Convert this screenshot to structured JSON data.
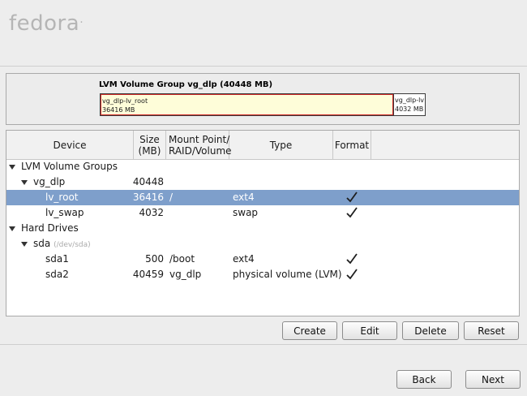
{
  "header": {
    "logo_text": "fedora",
    "logo_mark": "."
  },
  "vg_graphic": {
    "title": "LVM Volume Group vg_dlp (40448 MB)",
    "segments": [
      {
        "name": "vg_dlp-lv_root",
        "size": "36416 MB"
      },
      {
        "name": "vg_dlp-lv",
        "size": "4032 MB"
      }
    ]
  },
  "table": {
    "columns": {
      "device": "Device",
      "size_1": "Size",
      "size_2": "(MB)",
      "mount_1": "Mount Point/",
      "mount_2": "RAID/Volume",
      "type": "Type",
      "format": "Format"
    },
    "rows": [
      {
        "device": "LVM Volume Groups"
      },
      {
        "device": "vg_dlp",
        "size": "40448"
      },
      {
        "device": "lv_root",
        "size": "36416",
        "mount": "/",
        "type": "ext4",
        "format": true,
        "selected": true
      },
      {
        "device": "lv_swap",
        "size": "4032",
        "mount": "",
        "type": "swap",
        "format": true
      },
      {
        "device": "Hard Drives"
      },
      {
        "device": "sda",
        "hint": "(/dev/sda)"
      },
      {
        "device": "sda1",
        "size": "500",
        "mount": "/boot",
        "type": "ext4",
        "format": true
      },
      {
        "device": "sda2",
        "size": "40459",
        "mount": "vg_dlp",
        "type": "physical volume (LVM)",
        "format": true
      }
    ]
  },
  "actions": {
    "create": "Create",
    "edit": "Edit",
    "delete": "Delete",
    "reset": "Reset"
  },
  "nav": {
    "back": "Back",
    "next": "Next"
  }
}
